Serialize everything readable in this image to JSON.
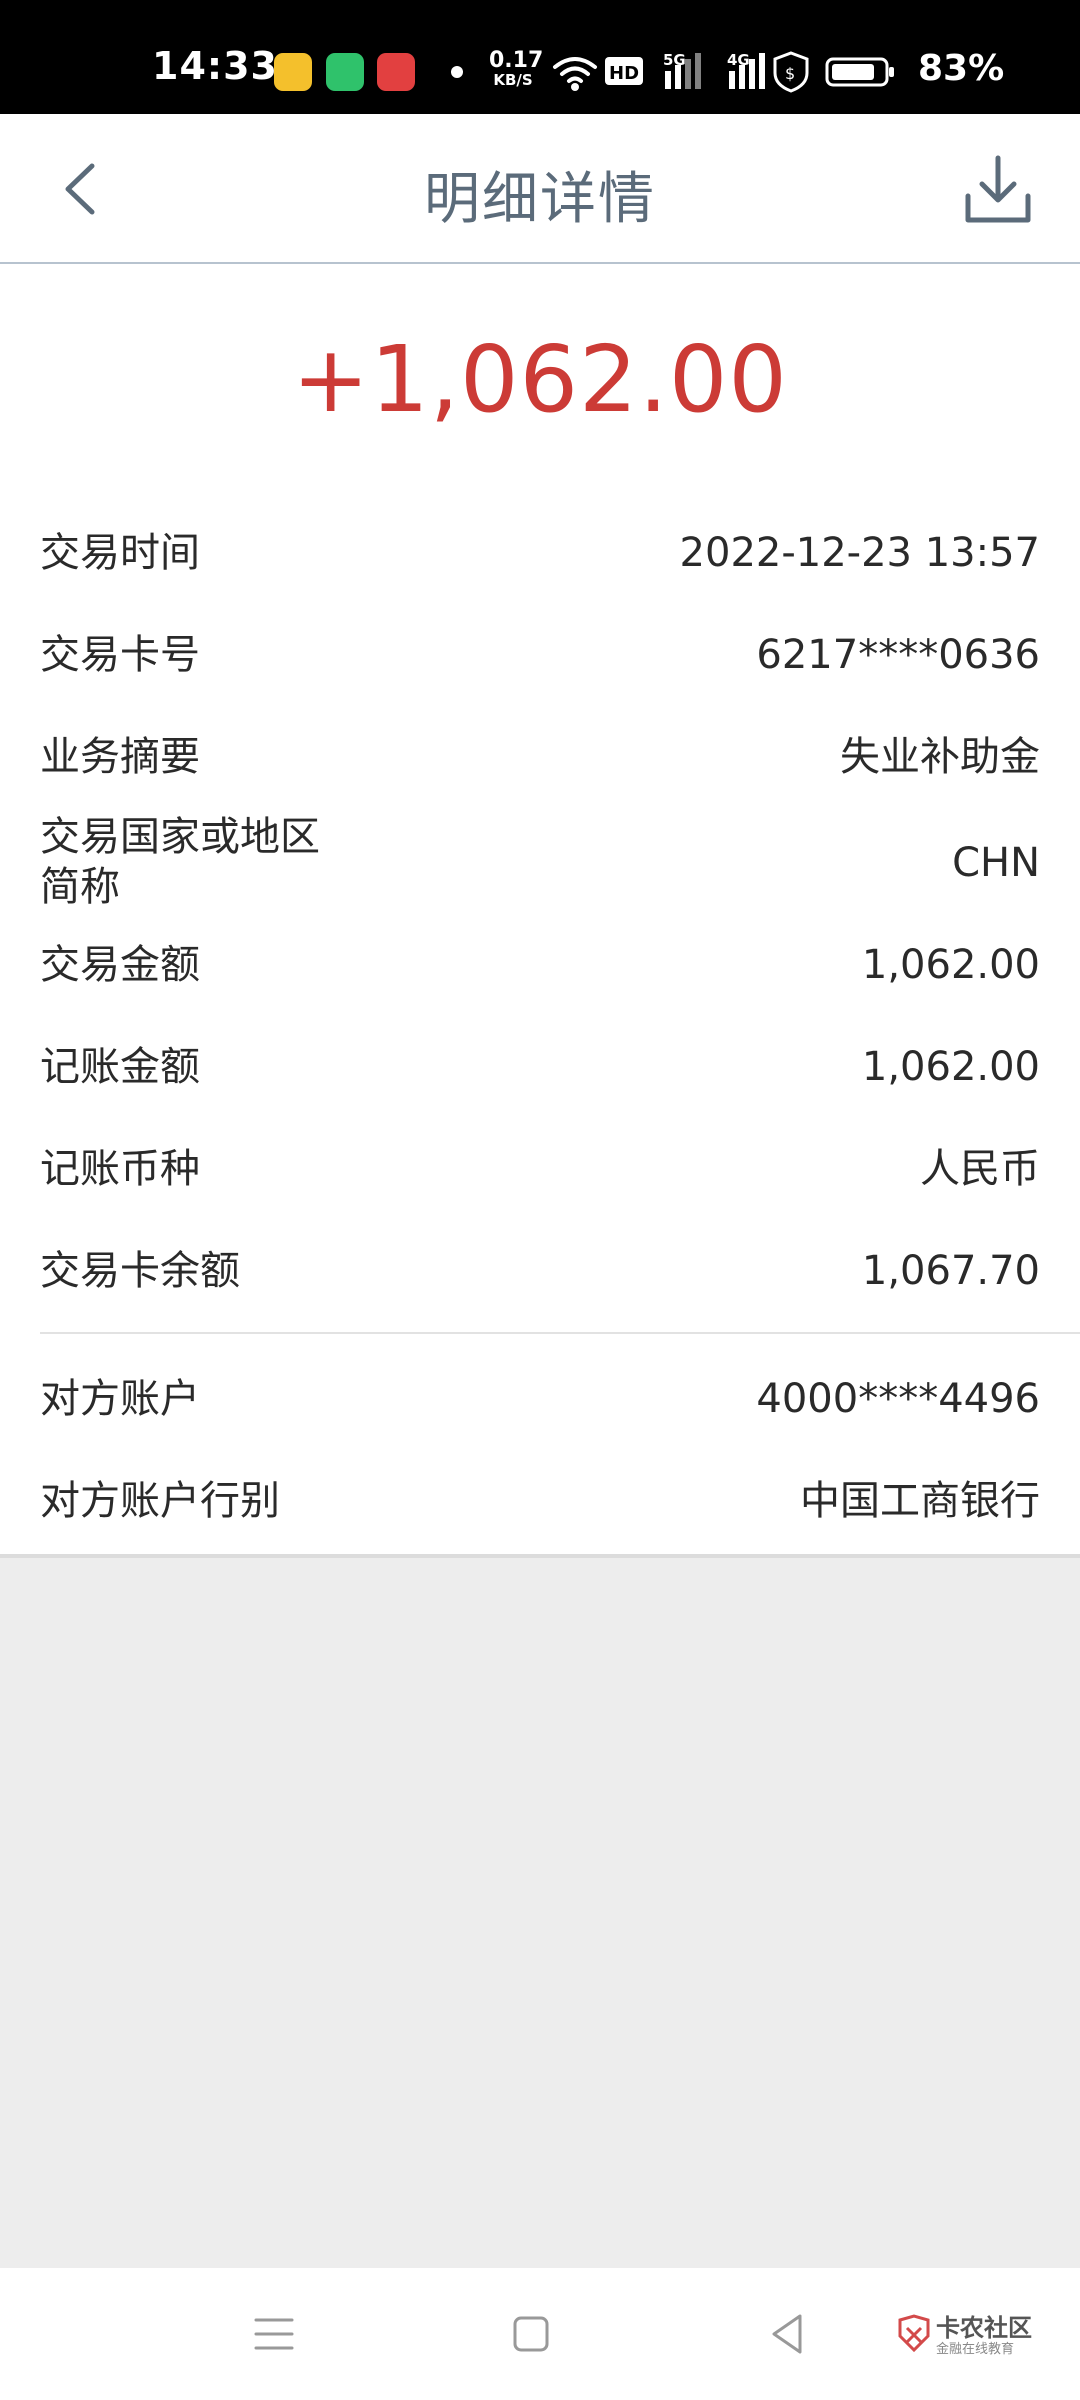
{
  "status_bar": {
    "time": "14:33",
    "speed_value": "0.17",
    "speed_unit": "KB/S",
    "battery_percent": "83%"
  },
  "header": {
    "title": "明细详情"
  },
  "amount": "+1,062.00",
  "details": [
    {
      "label": "交易时间",
      "value": "2022-12-23 13:57"
    },
    {
      "label": "交易卡号",
      "value": "6217****0636"
    },
    {
      "label": "业务摘要",
      "value": "失业补助金"
    },
    {
      "label": "交易国家或地区\n简称",
      "value": "CHN"
    },
    {
      "label": "交易金额",
      "value": "1,062.00"
    },
    {
      "label": "记账金额",
      "value": "1,062.00"
    },
    {
      "label": "记账币种",
      "value": "人民币"
    },
    {
      "label": "交易卡余额",
      "value": "1,067.70"
    }
  ],
  "counterparty": [
    {
      "label": "对方账户",
      "value": "4000****4496"
    },
    {
      "label": "对方账户行别",
      "value": "中国工商银行"
    }
  ],
  "watermark": {
    "text": "卡农社区",
    "sub": "金融在线教育"
  },
  "colors": {
    "amount": "#cc3b36",
    "title": "#5b6b7a",
    "icon": "#5b6b7a"
  }
}
